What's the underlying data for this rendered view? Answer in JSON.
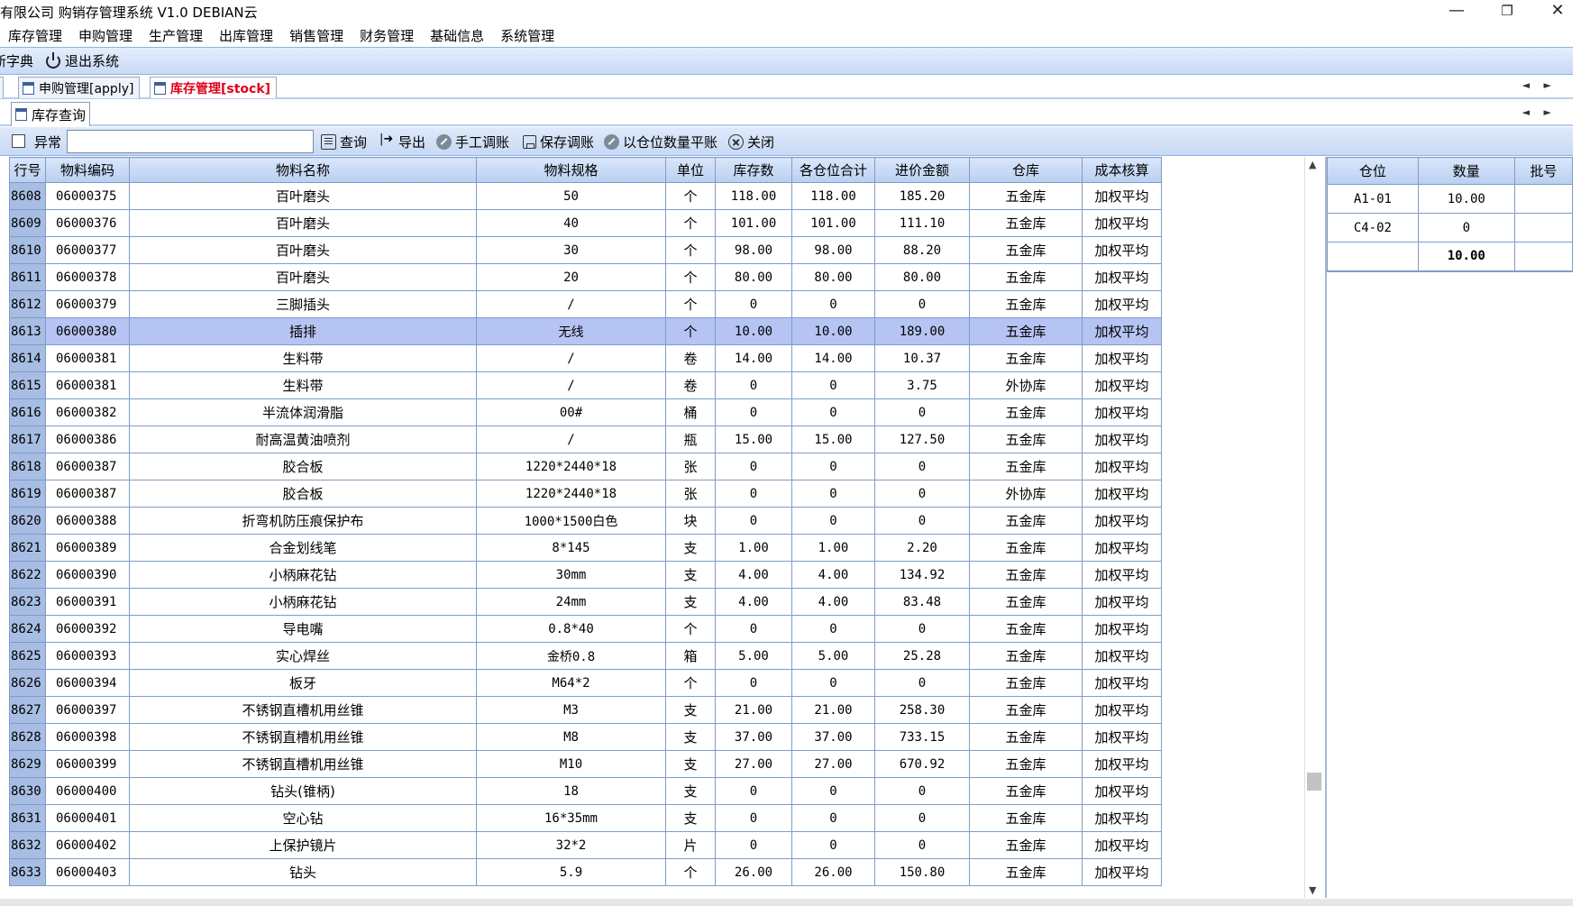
{
  "window": {
    "title": "有限公司 购销存管理系统 V1.0 DEBIAN云",
    "minimize": "—",
    "maximize": "❐",
    "close": "✕"
  },
  "menu": [
    "库存管理",
    "申购管理",
    "生产管理",
    "出库管理",
    "销售管理",
    "财务管理",
    "基础信息",
    "系统管理"
  ],
  "toolbar": {
    "dictionary": "新字典",
    "exit": "退出系统"
  },
  "tabs": [
    {
      "label": "申购管理[apply]"
    },
    {
      "label": "库存管理[stock]"
    }
  ],
  "inner_tab": "库存查询",
  "search": {
    "checkbox_label": "异常",
    "value": "",
    "buttons": {
      "query": "查询",
      "export": "导出",
      "manual_adjust": "手工调账",
      "save_adjust": "保存调账",
      "balance": "以仓位数量平账",
      "close": "关闭"
    }
  },
  "grid": {
    "columns": [
      "行号",
      "物料编码",
      "物料名称",
      "物料规格",
      "单位",
      "库存数",
      "各仓位合计",
      "进价金额",
      "仓库",
      "成本核算"
    ],
    "selected_row": "8613",
    "rows": [
      [
        "8608",
        "06000375",
        "百叶磨头",
        "50",
        "个",
        "118.00",
        "118.00",
        "185.20",
        "五金库",
        "加权平均"
      ],
      [
        "8609",
        "06000376",
        "百叶磨头",
        "40",
        "个",
        "101.00",
        "101.00",
        "111.10",
        "五金库",
        "加权平均"
      ],
      [
        "8610",
        "06000377",
        "百叶磨头",
        "30",
        "个",
        "98.00",
        "98.00",
        "88.20",
        "五金库",
        "加权平均"
      ],
      [
        "8611",
        "06000378",
        "百叶磨头",
        "20",
        "个",
        "80.00",
        "80.00",
        "80.00",
        "五金库",
        "加权平均"
      ],
      [
        "8612",
        "06000379",
        "三脚插头",
        "/",
        "个",
        "0",
        "0",
        "0",
        "五金库",
        "加权平均"
      ],
      [
        "8613",
        "06000380",
        "插排",
        "无线",
        "个",
        "10.00",
        "10.00",
        "189.00",
        "五金库",
        "加权平均"
      ],
      [
        "8614",
        "06000381",
        "生料带",
        "/",
        "卷",
        "14.00",
        "14.00",
        "10.37",
        "五金库",
        "加权平均"
      ],
      [
        "8615",
        "06000381",
        "生料带",
        "/",
        "卷",
        "0",
        "0",
        "3.75",
        "外协库",
        "加权平均"
      ],
      [
        "8616",
        "06000382",
        "半流体润滑脂",
        "00#",
        "桶",
        "0",
        "0",
        "0",
        "五金库",
        "加权平均"
      ],
      [
        "8617",
        "06000386",
        "耐高温黄油喷剂",
        "/",
        "瓶",
        "15.00",
        "15.00",
        "127.50",
        "五金库",
        "加权平均"
      ],
      [
        "8618",
        "06000387",
        "胶合板",
        "1220*2440*18",
        "张",
        "0",
        "0",
        "0",
        "五金库",
        "加权平均"
      ],
      [
        "8619",
        "06000387",
        "胶合板",
        "1220*2440*18",
        "张",
        "0",
        "0",
        "0",
        "外协库",
        "加权平均"
      ],
      [
        "8620",
        "06000388",
        "折弯机防压痕保护布",
        "1000*1500白色",
        "块",
        "0",
        "0",
        "0",
        "五金库",
        "加权平均"
      ],
      [
        "8621",
        "06000389",
        "合金划线笔",
        "8*145",
        "支",
        "1.00",
        "1.00",
        "2.20",
        "五金库",
        "加权平均"
      ],
      [
        "8622",
        "06000390",
        "小柄麻花钻",
        "30mm",
        "支",
        "4.00",
        "4.00",
        "134.92",
        "五金库",
        "加权平均"
      ],
      [
        "8623",
        "06000391",
        "小柄麻花钻",
        "24mm",
        "支",
        "4.00",
        "4.00",
        "83.48",
        "五金库",
        "加权平均"
      ],
      [
        "8624",
        "06000392",
        "导电嘴",
        "0.8*40",
        "个",
        "0",
        "0",
        "0",
        "五金库",
        "加权平均"
      ],
      [
        "8625",
        "06000393",
        "实心焊丝",
        "金桥0.8",
        "箱",
        "5.00",
        "5.00",
        "25.28",
        "五金库",
        "加权平均"
      ],
      [
        "8626",
        "06000394",
        "板牙",
        "M64*2",
        "个",
        "0",
        "0",
        "0",
        "五金库",
        "加权平均"
      ],
      [
        "8627",
        "06000397",
        "不锈钢直槽机用丝锥",
        "M3",
        "支",
        "21.00",
        "21.00",
        "258.30",
        "五金库",
        "加权平均"
      ],
      [
        "8628",
        "06000398",
        "不锈钢直槽机用丝锥",
        "M8",
        "支",
        "37.00",
        "37.00",
        "733.15",
        "五金库",
        "加权平均"
      ],
      [
        "8629",
        "06000399",
        "不锈钢直槽机用丝锥",
        "M10",
        "支",
        "27.00",
        "27.00",
        "670.92",
        "五金库",
        "加权平均"
      ],
      [
        "8630",
        "06000400",
        "钻头(锥柄)",
        "18",
        "支",
        "0",
        "0",
        "0",
        "五金库",
        "加权平均"
      ],
      [
        "8631",
        "06000401",
        "空心钻",
        "16*35mm",
        "支",
        "0",
        "0",
        "0",
        "五金库",
        "加权平均"
      ],
      [
        "8632",
        "06000402",
        "上保护镜片",
        "32*2",
        "片",
        "0",
        "0",
        "0",
        "五金库",
        "加权平均"
      ],
      [
        "8633",
        "06000403",
        "钻头",
        "5.9",
        "个",
        "26.00",
        "26.00",
        "150.80",
        "五金库",
        "加权平均"
      ]
    ]
  },
  "scrollbar": {
    "up": "▲",
    "down": "▼",
    "position": 0.87
  },
  "location_panel": {
    "columns": [
      "仓位",
      "数量",
      "批号"
    ],
    "rows": [
      [
        "A1-01",
        "10.00",
        ""
      ],
      [
        "C4-02",
        "0",
        ""
      ]
    ],
    "total": "10.00"
  },
  "tab_scroll_arrows": "◄ ►"
}
